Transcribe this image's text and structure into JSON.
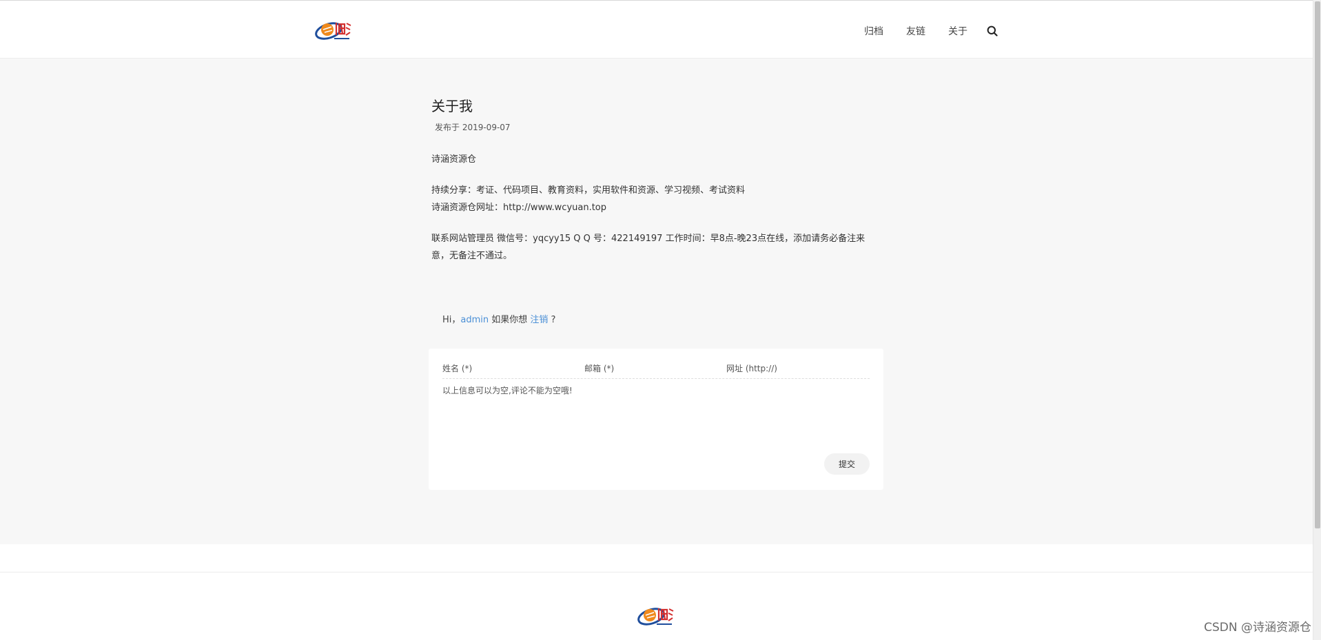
{
  "header": {
    "nav": {
      "archive": "归档",
      "links": "友链",
      "about": "关于"
    },
    "search_icon": "search-icon"
  },
  "article": {
    "title": "关于我",
    "meta": "发布于 2019-09-07",
    "paragraphs": {
      "intro": "诗涵资源仓",
      "share": "持续分享：考证、代码项目、教育资料，实用软件和资源、学习视频、考试资料",
      "site": "诗涵资源仓网址：http://www.wcyuan.top",
      "contact": "联系网站管理员 微信号：yqcyy15 Q Q 号：422149197 工作时间：早8点-晚23点在线，添加请务必备注来意，无备注不通过。"
    }
  },
  "comment": {
    "greeting_prefix": "Hi，",
    "user": "admin",
    "greeting_mid": " 如果你想 ",
    "logout": "注销",
    "greeting_suffix": " ?",
    "name_placeholder": "姓名 (*)",
    "email_placeholder": "邮箱 (*)",
    "url_placeholder": "网址 (http://)",
    "text_placeholder": "以上信息可以为空,评论不能为空哦!",
    "submit_label": "提交"
  },
  "watermark": "CSDN @诗涵资源仓",
  "colors": {
    "accent_link": "#4a8fd6",
    "background_main": "#f7f7f7",
    "logo_orange": "#f08a1c",
    "logo_blue": "#1f4e9c",
    "logo_red": "#d32f2f"
  }
}
